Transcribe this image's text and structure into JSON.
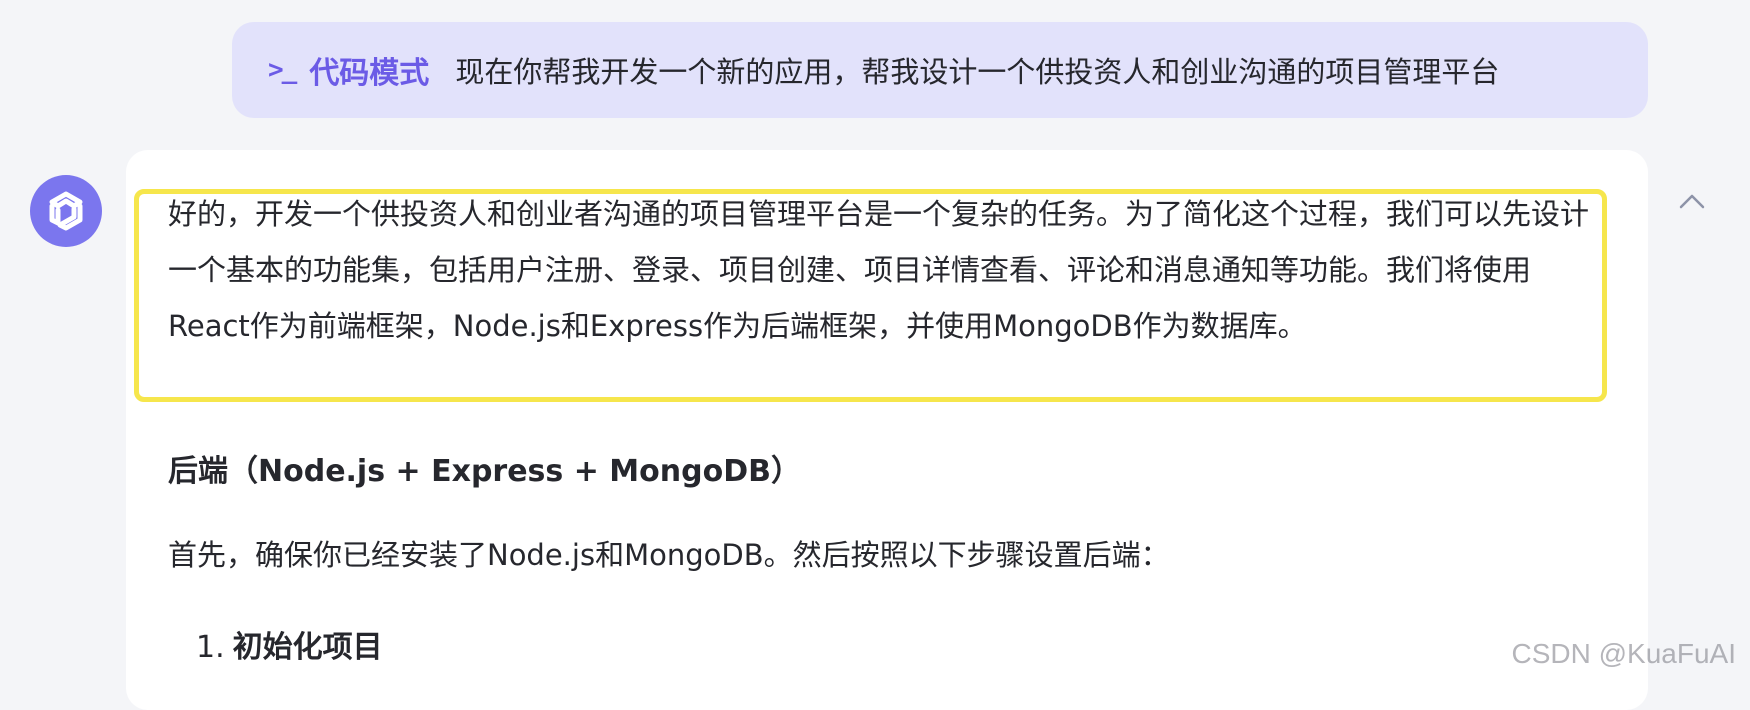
{
  "user_message": {
    "mode_icon": "terminal-prompt-icon",
    "mode_glyph": ">_",
    "mode_label": "代码模式",
    "text": "现在你帮我开发一个新的应用，帮我设计一个供投资人和创业沟通的项目管理平台"
  },
  "assistant": {
    "avatar_icon": "assistant-logo-icon",
    "intro": "好的，开发一个供投资人和创业者沟通的项目管理平台是一个复杂的任务。为了简化这个过程，我们可以先设计一个基本的功能集，包括用户注册、登录、项目创建、项目详情查看、评论和消息通知等功能。我们将使用React作为前端框架，Node.js和Express作为后端框架，并使用MongoDB作为数据库。",
    "section_heading": "后端（Node.js + Express + MongoDB）",
    "step_intro": "首先，确保你已经安装了Node.js和MongoDB。然后按照以下步骤设置后端：",
    "list": [
      {
        "number": "1.",
        "text": "初始化项目"
      }
    ],
    "collapse_icon": "chevron-up-icon"
  },
  "watermark": "CSDN @KuaFuAI",
  "colors": {
    "accent": "#6b5be6",
    "bubble": "#e2e2fb",
    "highlight": "#f6e64c",
    "avatar": "#7b76ee"
  }
}
